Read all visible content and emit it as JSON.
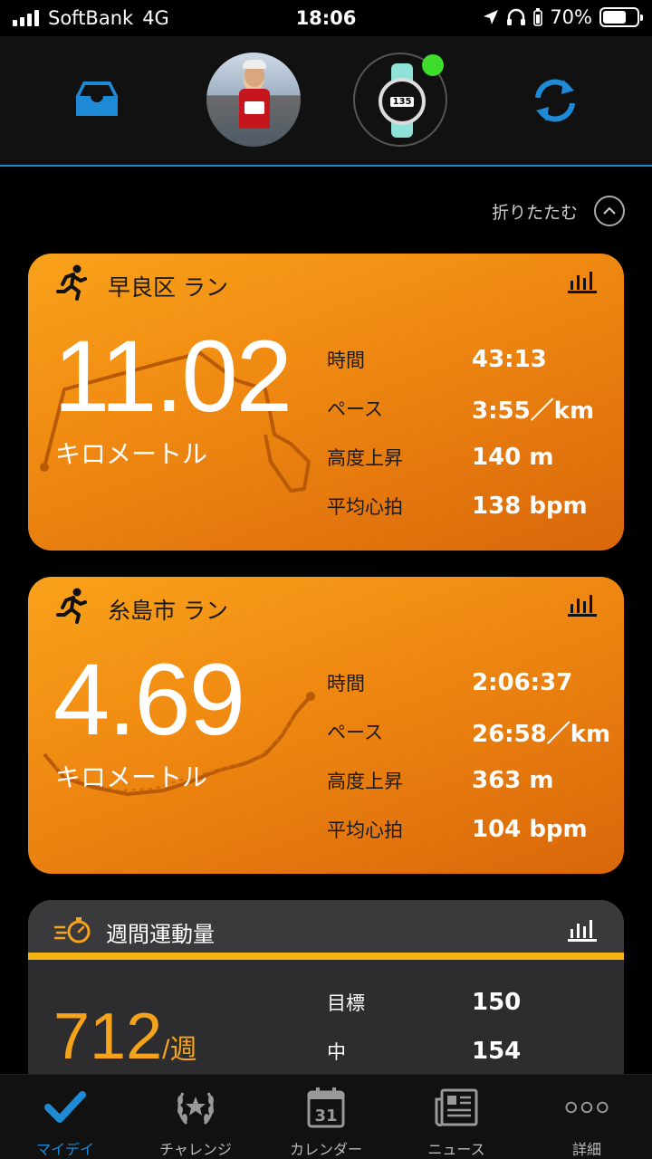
{
  "status": {
    "carrier": "SoftBank",
    "network": "4G",
    "time": "18:06",
    "battery": "70%",
    "battery_level": 0.7
  },
  "collapse_label": "折りたたむ",
  "activities": [
    {
      "title": "早良区 ラン",
      "distance": "11.02",
      "unit": "キロメートル",
      "stats": [
        {
          "label": "時間",
          "value": "43:13"
        },
        {
          "label": "ペース",
          "value": "3:55／km"
        },
        {
          "label": "高度上昇",
          "value": "140 m"
        },
        {
          "label": "平均心拍",
          "value": "138 bpm"
        }
      ]
    },
    {
      "title": "糸島市 ラン",
      "distance": "4.69",
      "unit": "キロメートル",
      "stats": [
        {
          "label": "時間",
          "value": "2:06:37"
        },
        {
          "label": "ペース",
          "value": "26:58／km"
        },
        {
          "label": "高度上昇",
          "value": "363 m"
        },
        {
          "label": "平均心拍",
          "value": "104 bpm"
        }
      ]
    }
  ],
  "weekly": {
    "title": "週間運動量",
    "value": "712",
    "unit": "/週",
    "stats": [
      {
        "label": "目標",
        "value": "150"
      },
      {
        "label": "中",
        "value": "154"
      }
    ]
  },
  "watch_face_text": "135",
  "tabs": [
    {
      "label": "マイデイ",
      "icon": "check-icon"
    },
    {
      "label": "チャレンジ",
      "icon": "laurel-icon"
    },
    {
      "label": "カレンダー",
      "icon": "calendar-icon",
      "day": "31"
    },
    {
      "label": "ニュース",
      "icon": "newspaper-icon"
    },
    {
      "label": "詳細",
      "icon": "more-icon"
    }
  ],
  "colors": {
    "accent": "#1e8ad6",
    "card_orange": "#f08a12",
    "weekly_value": "#f5a31a",
    "online_dot": "#3ddc2d"
  }
}
